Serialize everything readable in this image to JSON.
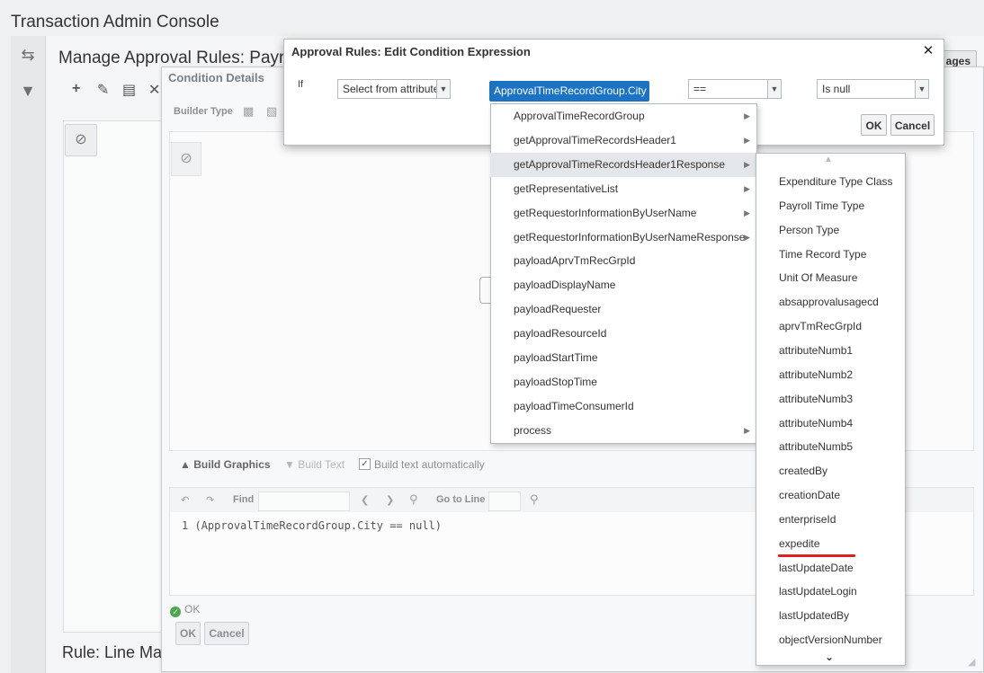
{
  "app": {
    "title": "Transaction Admin Console"
  },
  "page": {
    "title": "Manage Approval Rules: Payrol",
    "messages_label": "ages",
    "rule_line": "Rule: Line Ma"
  },
  "condition_panel": {
    "title": "Condition Details",
    "builder_type_label": "Builder Type",
    "build_graphics_label": "Build Graphics",
    "build_text_label": "Build Text",
    "build_auto_label": "Build text automatically",
    "find_label": "Find",
    "goto_label": "Go to Line",
    "code_line_number": "1",
    "code_text": "(ApprovalTimeRecordGroup.City == null)",
    "status_text": "OK",
    "ok_label": "OK",
    "cancel_label": "Cancel"
  },
  "dialog": {
    "title": "Approval Rules: Edit Condition Expression",
    "if_label": "If",
    "attribute_select": "Select from attribute",
    "attribute_chip": "ApprovalTimeRecordGroup.City",
    "operator": "==",
    "value": "Is null",
    "ok_label": "OK",
    "cancel_label": "Cancel"
  },
  "attribute_menu": {
    "items": [
      {
        "label": "ApprovalTimeRecordGroup",
        "has_submenu": true
      },
      {
        "label": "getApprovalTimeRecordsHeader1",
        "has_submenu": true
      },
      {
        "label": "getApprovalTimeRecordsHeader1Response",
        "has_submenu": true,
        "highlighted": true
      },
      {
        "label": "getRepresentativeList",
        "has_submenu": true
      },
      {
        "label": "getRequestorInformationByUserName",
        "has_submenu": true
      },
      {
        "label": "getRequestorInformationByUserNameResponse",
        "has_submenu": true
      },
      {
        "label": "payloadAprvTmRecGrpId",
        "has_submenu": false
      },
      {
        "label": "payloadDisplayName",
        "has_submenu": false
      },
      {
        "label": "payloadRequester",
        "has_submenu": false
      },
      {
        "label": "payloadResourceId",
        "has_submenu": false
      },
      {
        "label": "payloadStartTime",
        "has_submenu": false
      },
      {
        "label": "payloadStopTime",
        "has_submenu": false
      },
      {
        "label": "payloadTimeConsumerId",
        "has_submenu": false
      },
      {
        "label": "process",
        "has_submenu": true
      }
    ]
  },
  "sub_menu": {
    "items": [
      "Expenditure Type Class",
      "Payroll Time Type",
      "Person Type",
      "Time Record Type",
      "Unit Of Measure",
      "absapprovalusagecd",
      "aprvTmRecGrpId",
      "attributeNumb1",
      "attributeNumb2",
      "attributeNumb3",
      "attributeNumb4",
      "attributeNumb5",
      "createdBy",
      "creationDate",
      "enterpriseId",
      "expedite",
      "lastUpdateDate",
      "lastUpdateLogin",
      "lastUpdatedBy",
      "objectVersionNumber"
    ],
    "underlined_item": "expedite",
    "accent_color": "#e0201e"
  },
  "colors": {
    "selection": "#1c73c4",
    "ok_status": "#4aa84a"
  }
}
